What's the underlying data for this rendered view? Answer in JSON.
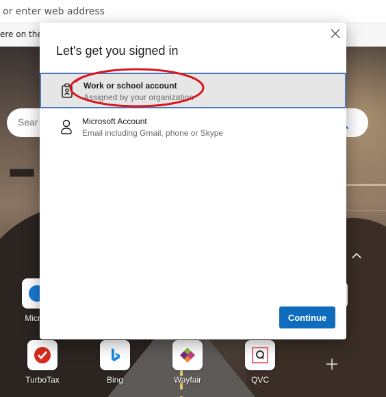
{
  "browser": {
    "address_placeholder": "or enter web address",
    "favorites_text": "ere on the f"
  },
  "newtab": {
    "search_placeholder": "Sear",
    "quick_links_top": [
      {
        "label": "Micros"
      }
    ],
    "quick_links": [
      {
        "label": "TurboTax",
        "icon": "turbotax-icon"
      },
      {
        "label": "Bing",
        "icon": "bing-icon"
      },
      {
        "label": "Wayfair",
        "icon": "wayfair-icon"
      },
      {
        "label": "QVC",
        "icon": "qvc-icon"
      }
    ]
  },
  "dialog": {
    "title": "Let's get you signed in",
    "options": [
      {
        "title": "Work or school account",
        "subtitle": "Assigned by your organization",
        "icon": "briefcase-badge-icon",
        "selected": true
      },
      {
        "title": "Microsoft Account",
        "subtitle": "Email including Gmail, phone or Skype",
        "icon": "person-icon",
        "selected": false
      }
    ],
    "continue_label": "Continue"
  },
  "colors": {
    "accent": "#0f6cbd",
    "selected_border": "#4a78b8",
    "annotation": "#d9141e"
  }
}
